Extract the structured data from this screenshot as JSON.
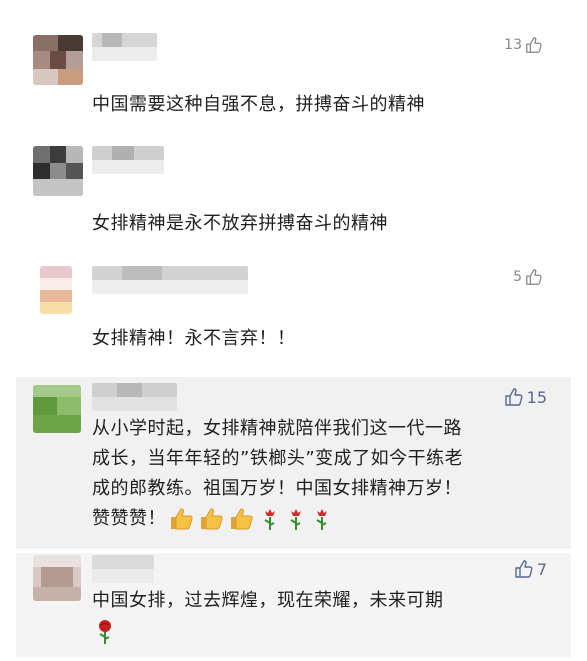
{
  "comments": [
    {
      "likes": "13",
      "text": "中国需要这种自强不息，拼搏奋斗的精神"
    },
    {
      "likes": "",
      "text": "女排精神是永不放弃拼搏奋斗的精神"
    },
    {
      "likes": "5",
      "text": "女排精神！永不言弃！！"
    },
    {
      "likes": "15",
      "text_line1": "从小学时起，女排精神就陪伴我们这一代一路",
      "text_line2": "成长，当年年轻的”铁榔头”变成了如今干练老",
      "text_line3": "成的郎教练。祖国万岁！中国女排精神万岁！",
      "text_line4": "赞赞赞！",
      "emojis": [
        "thumbs-up",
        "thumbs-up",
        "thumbs-up",
        "rose",
        "rose",
        "rose"
      ]
    },
    {
      "likes": "7",
      "text": "中国女排，过去辉煌，现在荣耀，未来可期",
      "emojis": [
        "rose"
      ]
    }
  ],
  "colors": {
    "text": "#1f1f1f",
    "likes": "#888888",
    "likes_active": "#576b95",
    "highlight_bg": "#f1f1f1"
  }
}
